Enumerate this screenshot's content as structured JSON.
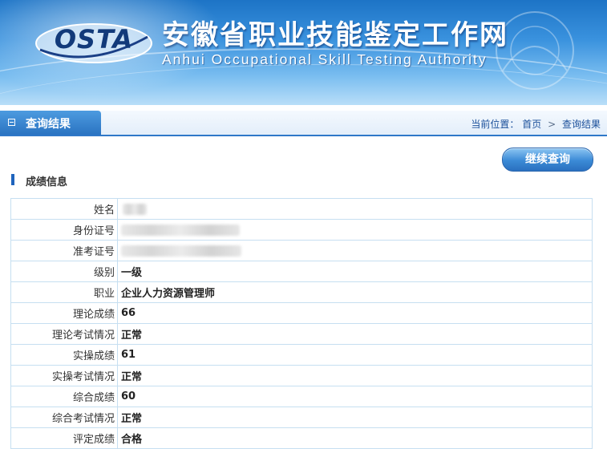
{
  "banner": {
    "logo_text": "OSTA",
    "title": "安徽省职业技能鉴定工作网",
    "subtitle": "Anhui Occupational Skill Testing Authority"
  },
  "bar": {
    "title": "查询结果",
    "breadcrumb_prefix": "当前位置：",
    "breadcrumb_home": "首页",
    "breadcrumb_sep": ">",
    "breadcrumb_current": "查询结果"
  },
  "content": {
    "continue_button": "继续查询",
    "section_title": "成绩信息",
    "rows": [
      {
        "key": "姓名",
        "value": ""
      },
      {
        "key": "身份证号",
        "value": ""
      },
      {
        "key": "准考证号",
        "value": ""
      },
      {
        "key": "级别",
        "value": "一级"
      },
      {
        "key": "职业",
        "value": "企业人力资源管理师"
      },
      {
        "key": "理论成绩",
        "value": "66"
      },
      {
        "key": "理论考试情况",
        "value": "正常"
      },
      {
        "key": "实操成绩",
        "value": "61"
      },
      {
        "key": "实操考试情况",
        "value": "正常"
      },
      {
        "key": "综合成绩",
        "value": "60"
      },
      {
        "key": "综合考试情况",
        "value": "正常"
      },
      {
        "key": "评定成绩",
        "value": "合格"
      }
    ]
  },
  "colors": {
    "accent": "#2f78c8",
    "banner_top": "#1d74c6",
    "logo": "#123a7a",
    "table_border": "#c6dff1"
  }
}
